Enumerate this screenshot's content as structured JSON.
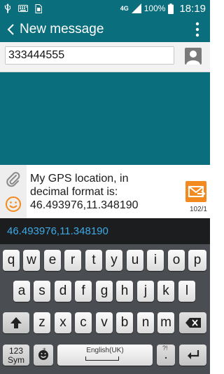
{
  "status_bar": {
    "network": "4G",
    "battery_percent": "100%",
    "time": "18:19",
    "icons_left": [
      "usb-icon",
      "keyboard-icon",
      "sim-icon"
    ],
    "icons_right": [
      "signal-icon",
      "battery-icon"
    ]
  },
  "app_bar": {
    "title": "New message",
    "back_icon": "chevron-left-icon",
    "menu_icon": "overflow-menu-icon"
  },
  "recipient": {
    "value": "333444555"
  },
  "compose": {
    "message": "My GPS location, in\ndecimal format is:\n46.493976,11.348190",
    "char_count": "102/1"
  },
  "suggestion_bar": {
    "suggestion": "46.493976,11.348190"
  },
  "keyboard": {
    "row1": [
      "q",
      "w",
      "e",
      "r",
      "t",
      "y",
      "u",
      "i",
      "o",
      "p"
    ],
    "row2": [
      "a",
      "s",
      "d",
      "f",
      "g",
      "h",
      "j",
      "k",
      "l"
    ],
    "row3": [
      "z",
      "x",
      "c",
      "v",
      "b",
      "n",
      "m"
    ],
    "sym_key": "123\nSym",
    "space_label": "English(UK)",
    "period_key": ".",
    "period_alt": "?!"
  },
  "colors": {
    "primary": "#0b6e7d",
    "send_button": "#f28a1f",
    "suggestion_text": "#3ea9e6"
  }
}
